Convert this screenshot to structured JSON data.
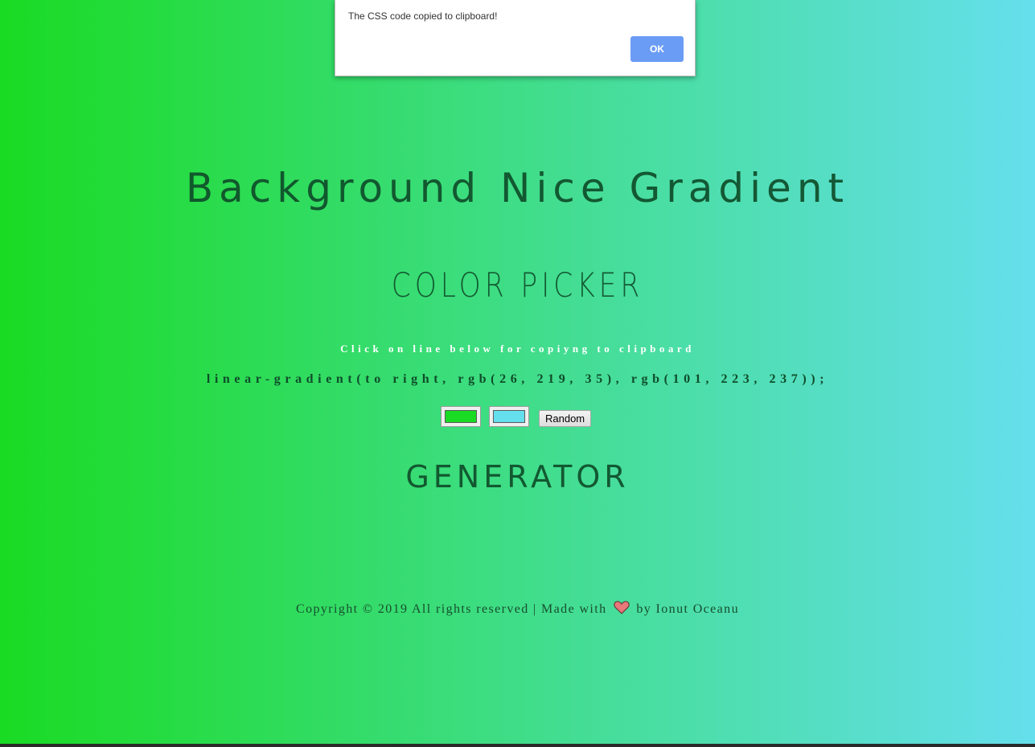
{
  "alert": {
    "message": "The CSS code copied to clipboard!",
    "ok_label": "OK"
  },
  "header": {
    "title": "Background Nice Gradient",
    "subtitle": "COLOR PICKER"
  },
  "main": {
    "instruction": "Click on line below for copiyng to clipboard",
    "css_code": "linear-gradient(to right, rgb(26, 219, 35), rgb(101, 223, 237));",
    "color1": "#1adb23",
    "color2": "#65dfed",
    "random_label": "Random",
    "generator_label": "GENERATOR"
  },
  "footer": {
    "prefix": "Copyright © 2019 All rights reserved | Made with",
    "heart_icon": "heart-icon",
    "suffix": "by Ionut Oceanu"
  },
  "colors": {
    "gradient_start": "rgb(26, 219, 35)",
    "gradient_end": "rgb(101, 223, 237)",
    "ok_button": "#6b9cf5",
    "heading_text": "#0f4d2a"
  }
}
